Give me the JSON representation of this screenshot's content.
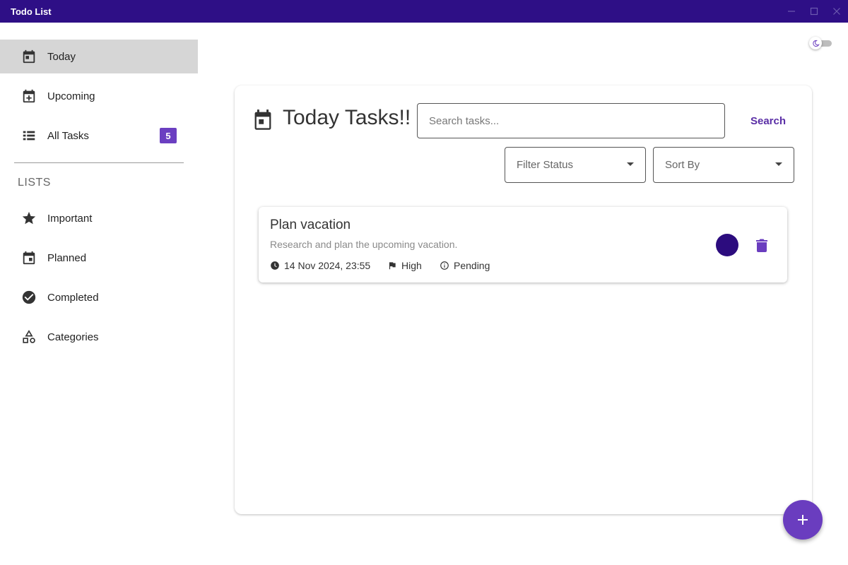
{
  "window": {
    "title": "Todo List",
    "controls": [
      "minimize-icon",
      "maximize-icon",
      "close-icon"
    ]
  },
  "sidebar": {
    "items": [
      {
        "label": "Today",
        "icon": "calendar-today-icon",
        "active": true
      },
      {
        "label": "Upcoming",
        "icon": "calendar-add-icon"
      },
      {
        "label": "All Tasks",
        "icon": "list-icon",
        "badge": "5"
      }
    ],
    "section_label": "LISTS",
    "lists": [
      {
        "label": "Important",
        "icon": "star-icon"
      },
      {
        "label": "Planned",
        "icon": "calendar-icon"
      },
      {
        "label": "Completed",
        "icon": "check-circle-icon"
      },
      {
        "label": "Categories",
        "icon": "category-shapes-icon"
      }
    ]
  },
  "theme_toggle": {
    "icon": "moon-icon",
    "on": false
  },
  "main": {
    "heading": "Today Tasks!!",
    "heading_icon": "calendar-icon",
    "search": {
      "placeholder": "Search tasks...",
      "value": "",
      "button_label": "Search"
    },
    "filter_status": {
      "placeholder": "Filter Status"
    },
    "sort_by": {
      "placeholder": "Sort By"
    },
    "tasks": [
      {
        "title": "Plan vacation",
        "description": "Research and plan the upcoming vacation.",
        "due": "14 Nov 2024, 23:55",
        "priority": "High",
        "status": "Pending"
      }
    ]
  },
  "fab": {
    "icon": "plus-icon"
  },
  "colors": {
    "titlebar": "#2e0f86",
    "accent": "#6a3dbf",
    "active_nav": "#d6d6d6",
    "status_dot": "#2c0c7e"
  }
}
